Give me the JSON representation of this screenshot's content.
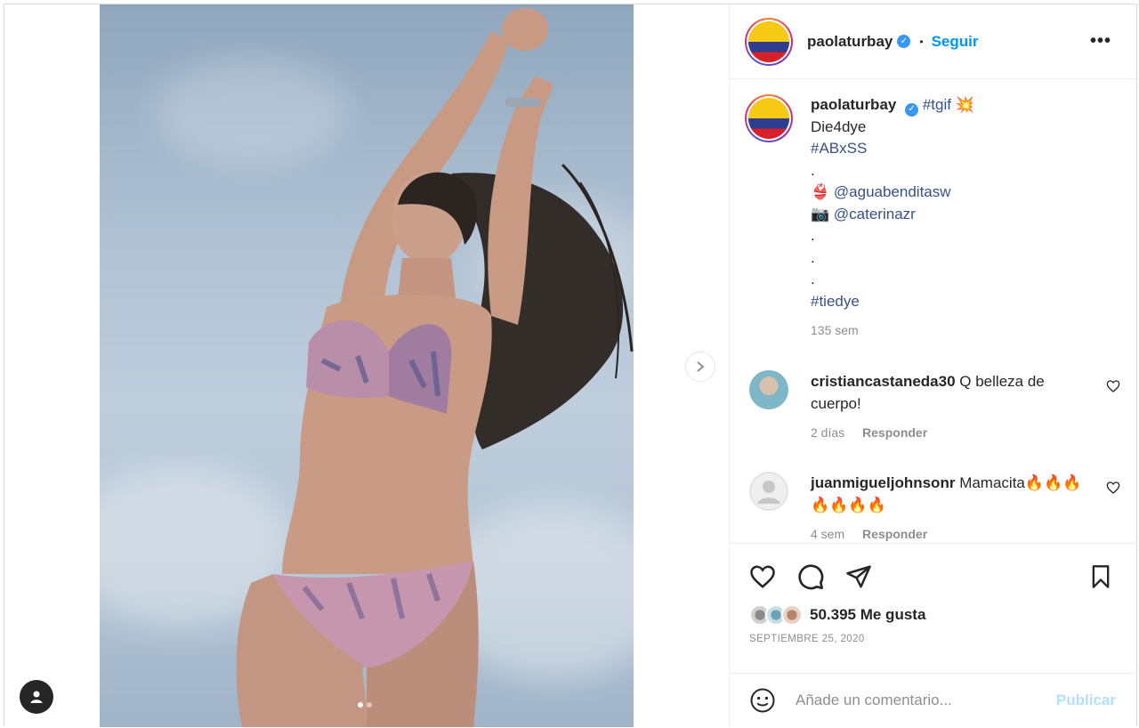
{
  "post": {
    "username": "paolaturbay",
    "follow_label": "Seguir",
    "separator": "•",
    "more_icon": "more-dots-icon",
    "verified_icon": "✓"
  },
  "caption": {
    "username": "paolaturbay",
    "hashtag_tgif": "#tgif",
    "emoji_collision": "💥",
    "line_die4dye": "Die4dye",
    "hashtag_abxss": "#ABxSS",
    "dot1": ".",
    "bikini_emoji": "👙",
    "mention_agua": "@aguabenditasw",
    "camera_emoji": "📷",
    "mention_caterina": "@caterinazr",
    "dot2": ".",
    "dot3": ".",
    "dot4": ".",
    "hashtag_tiedye": "#tiedye",
    "time": "135 sem"
  },
  "comments": [
    {
      "username": "cristiancastaneda30",
      "text": "Q belleza de cuerpo!",
      "time": "2 días",
      "reply": "Responder"
    },
    {
      "username": "juanmigueljohnsonr",
      "text": "Mamacita🔥🔥🔥🔥🔥🔥🔥",
      "time": "4 sem",
      "reply": "Responder"
    }
  ],
  "footer": {
    "likes": "50.395 Me gusta",
    "date": "SEPTIEMBRE 25, 2020",
    "comment_placeholder": "Añade un comentario...",
    "publish_label": "Publicar"
  },
  "carousel": {
    "total_slides": 2,
    "current_slide": 1
  },
  "colors": {
    "link_blue": "#0095f6",
    "tag_blue": "#385185",
    "muted": "#8e8e8e",
    "publish_disabled": "#b2dffc"
  }
}
